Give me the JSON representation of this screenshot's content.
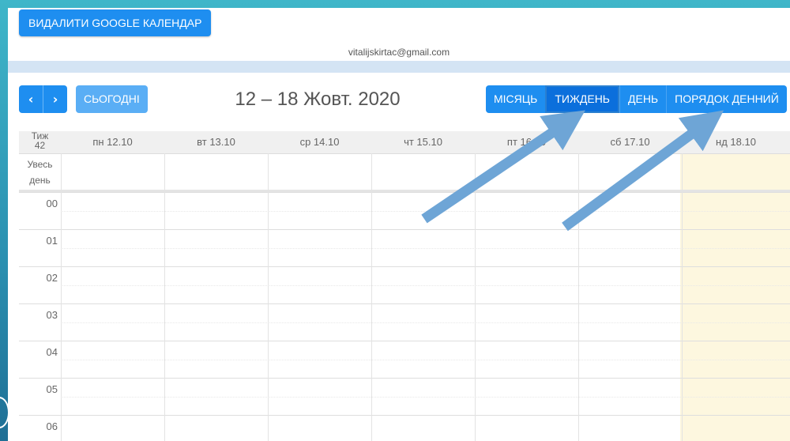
{
  "header": {
    "remove_button": "ВИДАЛИТИ GOOGLE КАЛЕНДАР",
    "email": "vitalijskirtac@gmail.com"
  },
  "toolbar": {
    "prev_icon": "chevron-left-icon",
    "next_icon": "chevron-right-icon",
    "prev_glyph": "‹",
    "next_glyph": "›",
    "today_label": "СЬОГОДНІ",
    "period_title": "12 – 18 Жовт. 2020",
    "views": [
      {
        "label": "МІСЯЦЬ",
        "active": false
      },
      {
        "label": "ТИЖДЕНЬ",
        "active": true
      },
      {
        "label": "ДЕНЬ",
        "active": false
      },
      {
        "label": "ПОРЯДОК ДЕННИЙ",
        "active": false
      }
    ]
  },
  "grid": {
    "week_label_line1": "Тиж",
    "week_label_line2": "42",
    "days": [
      "пн 12.10",
      "вт 13.10",
      "ср 14.10",
      "чт 15.10",
      "пт 16.10",
      "сб 17.10",
      "нд 18.10"
    ],
    "allday_line1": "Увесь",
    "allday_line2": "день",
    "hours": [
      "00",
      "01",
      "02",
      "03",
      "04",
      "05",
      "06"
    ],
    "today_index": 6
  },
  "colors": {
    "primary": "#1e8ef0",
    "active_view": "#0b6fdc",
    "today_bg": "#fdf7df",
    "arrow": "#6ea5d6"
  }
}
